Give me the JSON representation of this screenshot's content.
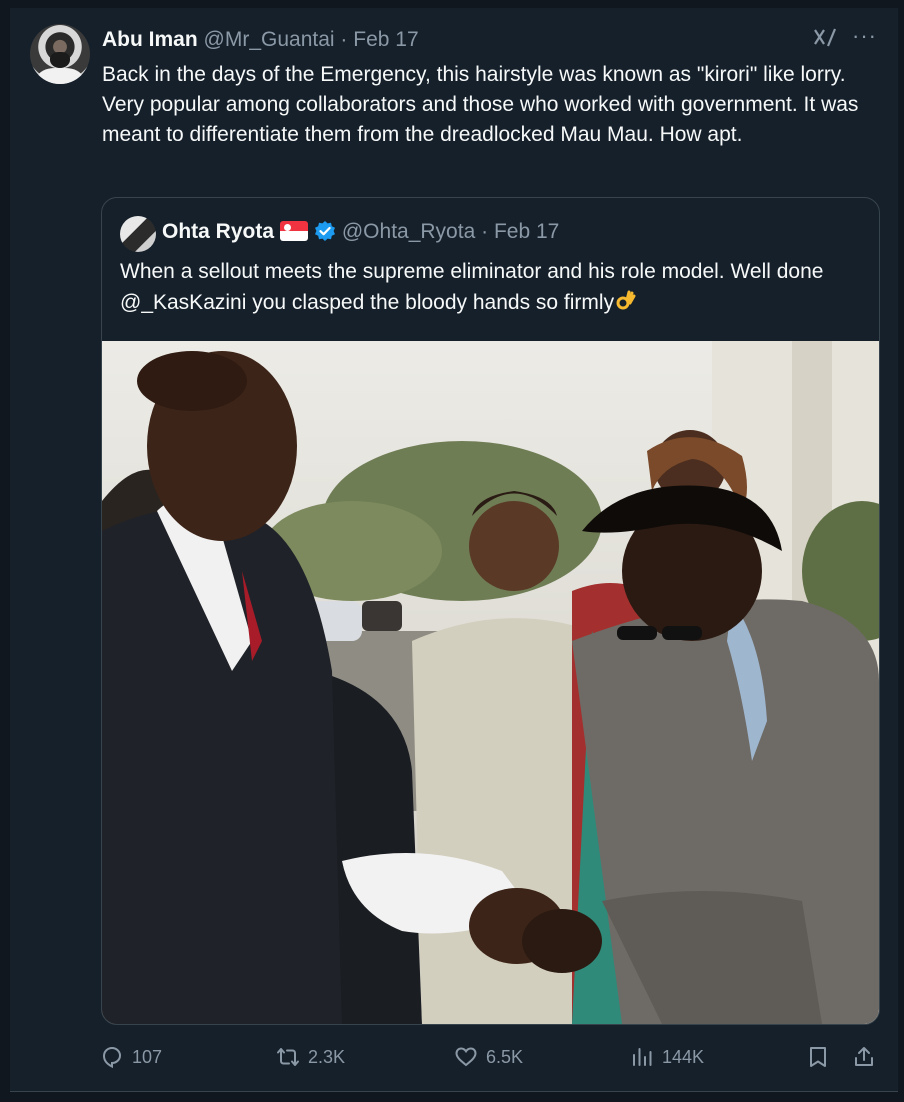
{
  "post": {
    "author_name": "Abu Iman",
    "author_handle": "@Mr_Guantai",
    "separator": "·",
    "date": "Feb 17",
    "text": "Back in the days of the Emergency, this hairstyle was known as \"kirori\" like lorry. Very popular among collaborators and those who worked with government. It was meant to differentiate them from the dreadlocked Mau Mau. How apt.",
    "more_icon": "···"
  },
  "quoted_post": {
    "author_name": "Ohta Ryota",
    "flag_icon": "singapore-flag-icon",
    "verified_icon": "verified-badge-icon",
    "author_handle": "@Ohta_Ryota",
    "separator": "·",
    "date": "Feb 17",
    "text": "When a sellout meets the supreme eliminator and his role model. Well done @_KasKazini  you clasped the bloody hands so firmly",
    "emoji": "ok-hand-icon",
    "image": "handshake-photo"
  },
  "actions": {
    "replies": "107",
    "reposts": "2.3K",
    "likes": "6.5K",
    "views": "144K"
  },
  "colors": {
    "background": "#15202b",
    "text_primary": "#f7f9f9",
    "text_secondary": "#8b98a5",
    "border": "#38444d",
    "verified": "#1d9bf0"
  }
}
